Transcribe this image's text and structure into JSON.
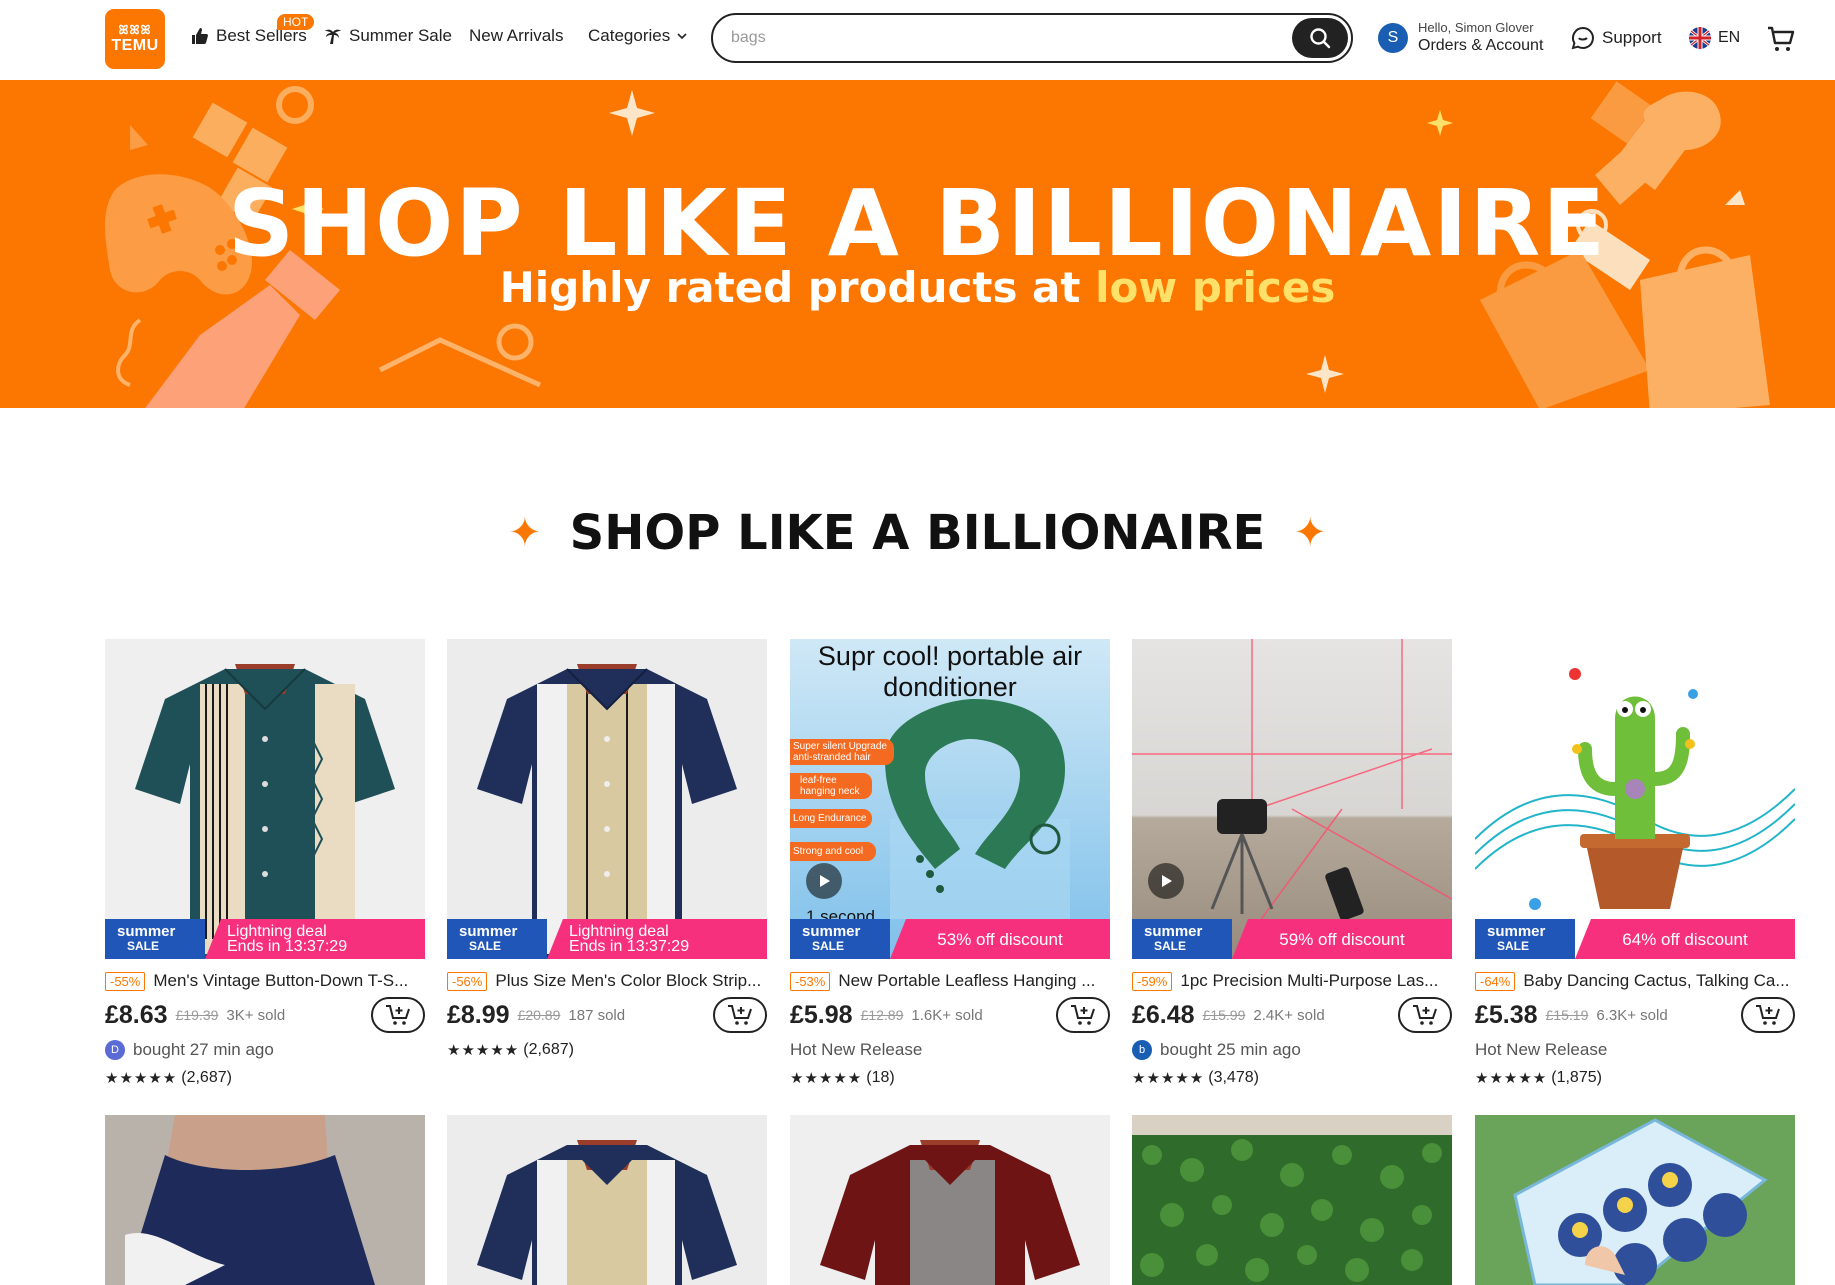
{
  "header": {
    "logo_glyphs": "ꕤꕤꕤ",
    "logo_word": "TEMU",
    "nav": {
      "best_sellers": "Best Sellers",
      "hot_badge": "HOT",
      "summer_sale": "Summer Sale",
      "new_arrivals": "New Arrivals",
      "categories": "Categories"
    },
    "search": {
      "value": "bags"
    },
    "account": {
      "avatar_letter": "S",
      "greeting": "Hello, Simon Glover",
      "label": "Orders & Account"
    },
    "support": "Support",
    "language": "EN"
  },
  "banner": {
    "title": "SHOP LIKE A BILLIONAIRE",
    "subtitle_main": "Highly rated products at ",
    "subtitle_highlight": "low prices"
  },
  "section": {
    "title": "SHOP LIKE A BILLIONAIRE"
  },
  "badge_text": {
    "summer": "summer",
    "sale": "SALE"
  },
  "products": [
    {
      "discount": "-55%",
      "title": "Men's Vintage Button-Down T-S...",
      "price": "£8.63",
      "orig": "£19.39",
      "sold": "3K+ sold",
      "strip_line1": "Lightning deal",
      "strip_line2": "Ends in 13:37:29",
      "meta": "bought 27 min ago",
      "meta_letter": "D",
      "stars": "★★★★★",
      "reviews": "(2,687)"
    },
    {
      "discount": "-56%",
      "title": "Plus Size Men's Color Block Strip...",
      "price": "£8.99",
      "orig": "£20.89",
      "sold": "187 sold",
      "strip_line1": "Lightning deal",
      "strip_line2": "Ends in 13:37:29",
      "stars": "★★★★★",
      "reviews": "(2,687)"
    },
    {
      "discount": "-53%",
      "title": "New Portable Leafless Hanging ...",
      "price": "£5.98",
      "orig": "£12.89",
      "sold": "1.6K+ sold",
      "strip_line1": "53% off discount",
      "meta": "Hot New Release",
      "stars": "★★★★★",
      "reviews": "(18)",
      "img_heading": "Supr cool! portable air donditioner",
      "img_tags": [
        "Super silent Upgrade anti-stranded hair",
        "leaf-free hanging neck",
        "Long Endurance",
        "Strong and cool"
      ],
      "img_caption": "1 second"
    },
    {
      "discount": "-59%",
      "title": "1pc Precision Multi-Purpose Las...",
      "price": "£6.48",
      "orig": "£15.99",
      "sold": "2.4K+ sold",
      "strip_line1": "59% off discount",
      "meta": "bought 25 min ago",
      "meta_letter": "b",
      "stars": "★★★★★",
      "reviews": "(3,478)"
    },
    {
      "discount": "-64%",
      "title": "Baby Dancing Cactus, Talking Ca...",
      "price": "£5.38",
      "orig": "£15.19",
      "sold": "6.3K+ sold",
      "strip_line1": "64% off discount",
      "meta": "Hot New Release",
      "stars": "★★★★★",
      "reviews": "(1,875)"
    }
  ],
  "colors": {
    "brand": "#fb7701",
    "sale_pink": "#f7307e",
    "sale_blue": "#1f56b8",
    "highlight": "#ffe16a"
  }
}
